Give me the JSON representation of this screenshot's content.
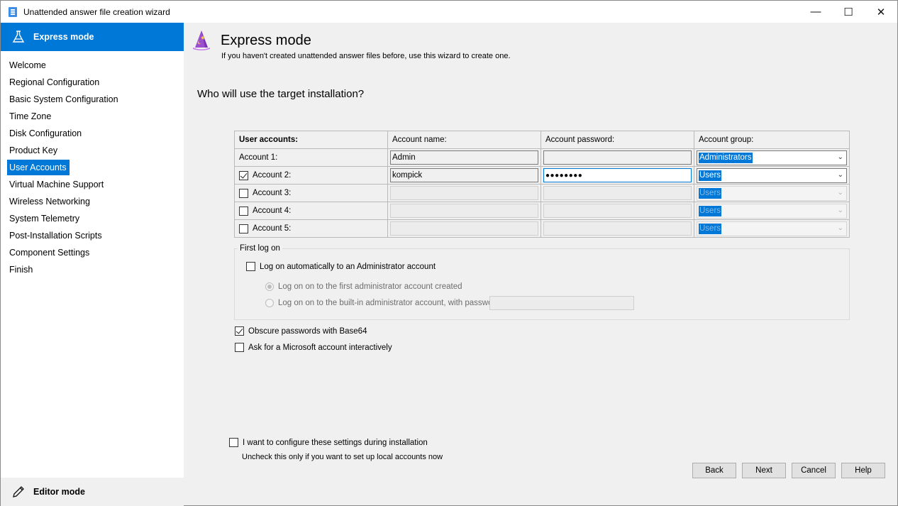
{
  "window": {
    "title": "Unattended answer file creation wizard",
    "minimize": "—",
    "maximize": "☐",
    "close": "✕"
  },
  "sidebar": {
    "header": "Express mode",
    "items": [
      {
        "label": "Welcome"
      },
      {
        "label": "Regional Configuration"
      },
      {
        "label": "Basic System Configuration"
      },
      {
        "label": "Time Zone"
      },
      {
        "label": "Disk Configuration"
      },
      {
        "label": "Product Key"
      },
      {
        "label": "User Accounts",
        "active": true
      },
      {
        "label": "Virtual Machine Support"
      },
      {
        "label": "Wireless Networking"
      },
      {
        "label": "System Telemetry"
      },
      {
        "label": "Post-Installation Scripts"
      },
      {
        "label": "Component Settings"
      },
      {
        "label": "Finish"
      }
    ],
    "footer": "Editor mode"
  },
  "header": {
    "title": "Express mode",
    "subtitle": "If you haven't created unattended answer files before, use this wizard to create one."
  },
  "question": "Who will use the target installation?",
  "accounts_table": {
    "headers": [
      "User accounts:",
      "Account name:",
      "Account password:",
      "Account group:"
    ],
    "rows": [
      {
        "label": "Account 1:",
        "has_checkbox": false,
        "checked": true,
        "name": "Admin",
        "password": "",
        "group": "Administrators",
        "enabled": true
      },
      {
        "label": "Account 2:",
        "has_checkbox": true,
        "checked": true,
        "name": "kompick",
        "password": "●●●●●●●●",
        "group": "Users",
        "enabled": true
      },
      {
        "label": "Account 3:",
        "has_checkbox": true,
        "checked": false,
        "name": "",
        "password": "",
        "group": "Users",
        "enabled": false
      },
      {
        "label": "Account 4:",
        "has_checkbox": true,
        "checked": false,
        "name": "",
        "password": "",
        "group": "Users",
        "enabled": false
      },
      {
        "label": "Account 5:",
        "has_checkbox": true,
        "checked": false,
        "name": "",
        "password": "",
        "group": "Users",
        "enabled": false
      }
    ]
  },
  "first_logon": {
    "group_label": "First log on",
    "auto_logon_label": "Log on automatically to an Administrator account",
    "auto_logon_checked": false,
    "option_first_admin": "Log on on to the first administrator account created",
    "option_builtin": "Log on on to the built-in administrator account, with password:",
    "builtin_password": ""
  },
  "options": {
    "obscure_label": "Obscure passwords with Base64",
    "obscure_checked": true,
    "ms_account_label": "Ask for a Microsoft account interactively",
    "ms_account_checked": false
  },
  "configure_later": {
    "label": "I want to configure these settings during installation",
    "checked": false,
    "hint": "Uncheck this only if you want to set up local accounts now"
  },
  "buttons": {
    "back": "Back",
    "next": "Next",
    "cancel": "Cancel",
    "help": "Help"
  },
  "colors": {
    "accent": "#0078d7",
    "sidebar_bg": "#ffffff",
    "window_bg": "#f0f0f0"
  }
}
